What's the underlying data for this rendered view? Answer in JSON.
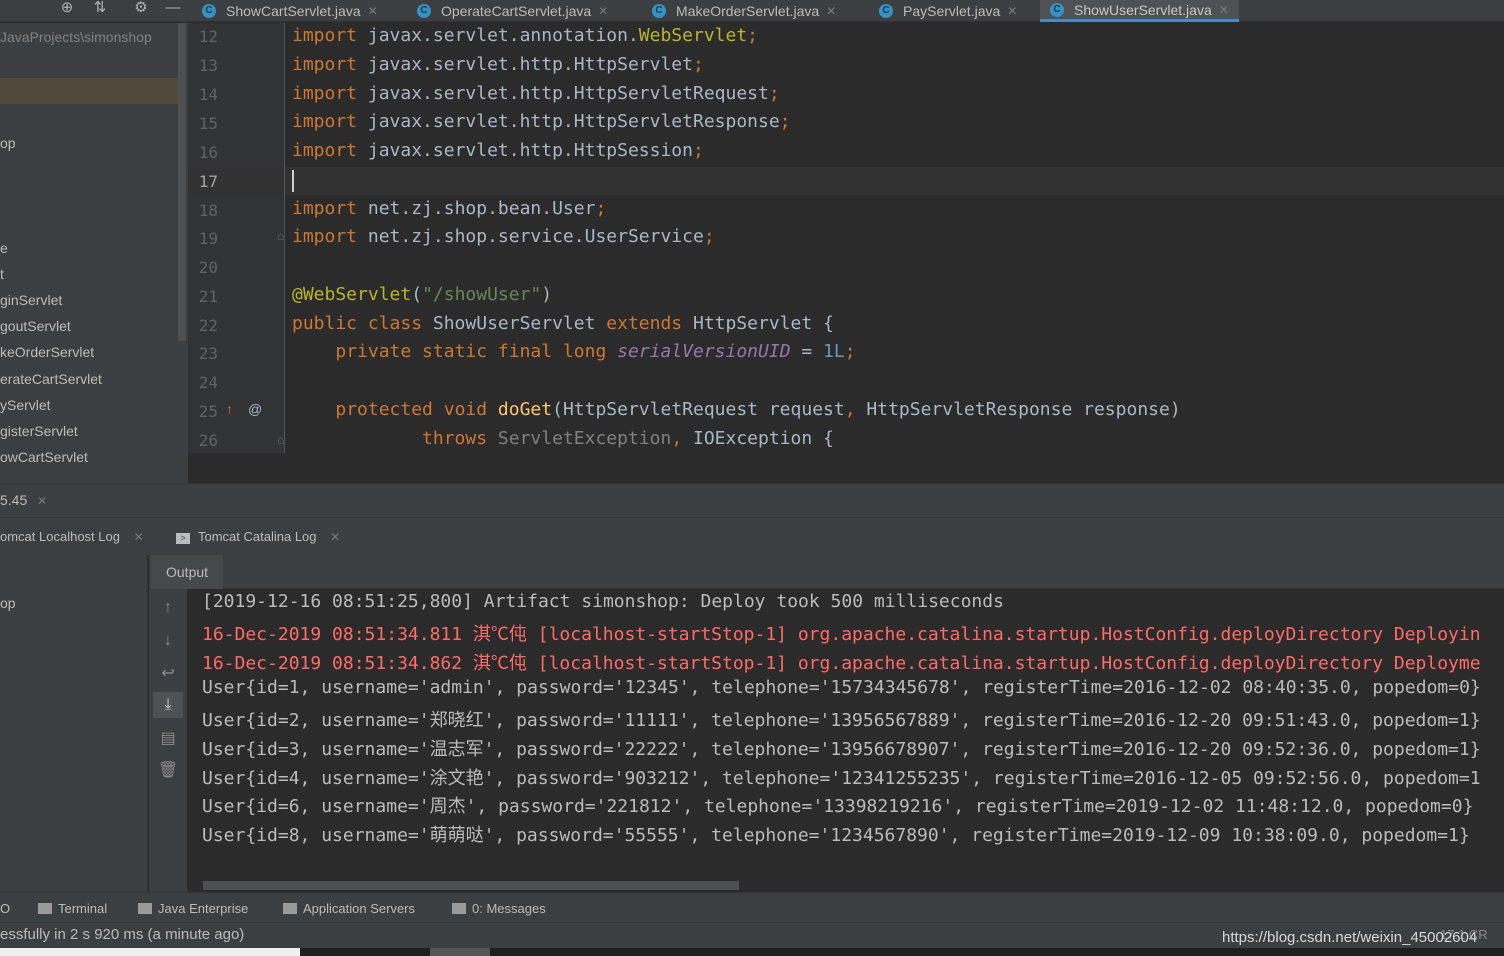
{
  "tabs": [
    {
      "label": "ShowCartServlet.java",
      "active": false
    },
    {
      "label": "OperateCartServlet.java",
      "active": false
    },
    {
      "label": "MakeOrderServlet.java",
      "active": false
    },
    {
      "label": "PayServlet.java",
      "active": false
    },
    {
      "label": "ShowUserServlet.java",
      "active": true
    }
  ],
  "project": {
    "path": "JavaProjects\\simonshop",
    "items": [
      "op",
      "e",
      "t",
      "ginServlet",
      "goutServlet",
      "keOrderServlet",
      "erateCartServlet",
      "yServlet",
      "gisterServlet",
      "owCartServlet"
    ]
  },
  "editor": {
    "line_numbers": [
      "12",
      "13",
      "14",
      "15",
      "16",
      "17",
      "18",
      "19",
      "20",
      "21",
      "22",
      "23",
      "24",
      "25",
      "26"
    ]
  },
  "run": {
    "tab_label": "5.45",
    "log_tabs": [
      "omcat Localhost Log",
      "Tomcat Catalina Log"
    ],
    "deploy_item": "op",
    "output_tab": "Output",
    "console_lines": [
      {
        "text": "[2019-12-16 08:51:25,800] Artifact simonshop: Deploy took 500 milliseconds",
        "level": "info"
      },
      {
        "text": "16-Dec-2019 08:51:34.811 淇℃伅 [localhost-startStop-1] org.apache.catalina.startup.HostConfig.deployDirectory Deployin",
        "level": "error"
      },
      {
        "text": "16-Dec-2019 08:51:34.862 淇℃伅 [localhost-startStop-1] org.apache.catalina.startup.HostConfig.deployDirectory Deployme",
        "level": "error"
      },
      {
        "text": "User{id=1, username='admin', password='12345', telephone='15734345678', registerTime=2016-12-02 08:40:35.0, popedom=0}",
        "level": "info"
      },
      {
        "text": "User{id=2, username='郑晓红', password='11111', telephone='13956567889', registerTime=2016-12-20 09:51:43.0, popedom=1}",
        "level": "info"
      },
      {
        "text": "User{id=3, username='温志军', password='22222', telephone='13956678907', registerTime=2016-12-20 09:52:36.0, popedom=1}",
        "level": "info"
      },
      {
        "text": "User{id=4, username='涂文艳', password='903212', telephone='12341255235', registerTime=2016-12-05 09:52:56.0, popedom=1",
        "level": "info"
      },
      {
        "text": "User{id=6, username='周杰', password='221812', telephone='13398219216', registerTime=2019-12-02 11:48:12.0, popedom=0}",
        "level": "info"
      },
      {
        "text": "User{id=8, username='萌萌哒', password='55555', telephone='1234567890', registerTime=2019-12-09 10:38:09.0, popedom=1}",
        "level": "info"
      }
    ]
  },
  "tool_windows": [
    "O",
    "Terminal",
    "Java Enterprise",
    "Application Servers",
    "0: Messages"
  ],
  "status": {
    "message": "essfully in 2 s 920 ms (a minute ago)",
    "position": "17:1  CR",
    "watermark": "https://blog.csdn.net/weixin_45002604"
  },
  "icons": [
    "crosshair-icon",
    "collapse-icon",
    "gear-icon",
    "minimize-icon",
    "java-class-icon",
    "close-icon",
    "override-marker-icon",
    "annotation-marker-icon",
    "fold-icon",
    "scroll-up-icon",
    "scroll-down-icon",
    "soft-wrap-icon",
    "scroll-to-end-icon",
    "print-icon",
    "trash-icon"
  ]
}
